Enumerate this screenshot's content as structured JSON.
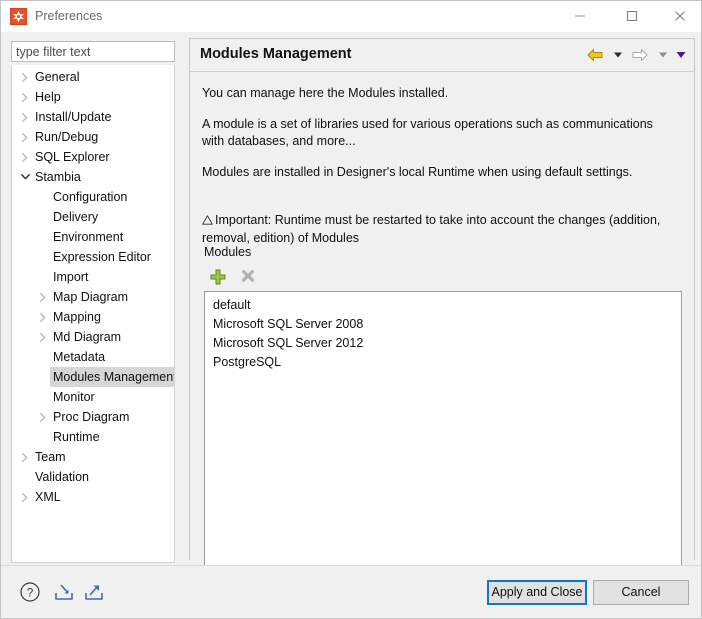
{
  "window": {
    "title": "Preferences",
    "app_icon": "stambia-logo-icon",
    "controls": {
      "minimize": "minimize-icon",
      "maximize": "maximize-icon",
      "close": "close-icon"
    }
  },
  "sidebar": {
    "filter": {
      "value": "",
      "placeholder": "type filter text"
    },
    "items": [
      {
        "label": "General",
        "indent": 0,
        "state": "collapsed"
      },
      {
        "label": "Help",
        "indent": 0,
        "state": "collapsed"
      },
      {
        "label": "Install/Update",
        "indent": 0,
        "state": "collapsed"
      },
      {
        "label": "Run/Debug",
        "indent": 0,
        "state": "collapsed"
      },
      {
        "label": "SQL Explorer",
        "indent": 0,
        "state": "collapsed"
      },
      {
        "label": "Stambia",
        "indent": 0,
        "state": "expanded"
      },
      {
        "label": "Configuration",
        "indent": 1,
        "state": "leaf"
      },
      {
        "label": "Delivery",
        "indent": 1,
        "state": "leaf"
      },
      {
        "label": "Environment",
        "indent": 1,
        "state": "leaf"
      },
      {
        "label": "Expression Editor",
        "indent": 1,
        "state": "leaf"
      },
      {
        "label": "Import",
        "indent": 1,
        "state": "leaf"
      },
      {
        "label": "Map Diagram",
        "indent": 1,
        "state": "collapsed"
      },
      {
        "label": "Mapping",
        "indent": 1,
        "state": "collapsed"
      },
      {
        "label": "Md Diagram",
        "indent": 1,
        "state": "collapsed"
      },
      {
        "label": "Metadata",
        "indent": 1,
        "state": "leaf"
      },
      {
        "label": "Modules Management",
        "indent": 1,
        "state": "leaf",
        "selected": true
      },
      {
        "label": "Monitor",
        "indent": 1,
        "state": "leaf"
      },
      {
        "label": "Proc Diagram",
        "indent": 1,
        "state": "collapsed"
      },
      {
        "label": "Runtime",
        "indent": 1,
        "state": "leaf"
      },
      {
        "label": "Team",
        "indent": 0,
        "state": "collapsed"
      },
      {
        "label": "Validation",
        "indent": 0,
        "state": "leaf"
      },
      {
        "label": "XML",
        "indent": 0,
        "state": "collapsed"
      }
    ]
  },
  "pane": {
    "title": "Modules Management",
    "nav": {
      "back": "back-arrow-icon",
      "back_menu": "chevron-down-icon",
      "forward": "forward-arrow-icon",
      "forward_menu": "chevron-down-icon",
      "view_menu": "chevron-down-icon"
    },
    "paragraphs": {
      "p1": "You can manage here the Modules installed.",
      "p2": "A module is a set of libraries used for various operations such as communications with databases, and more...",
      "p3": "Modules are installed in Designer's local Runtime when using default settings.",
      "p4_icon": "warning-triangle-icon",
      "p4": "Important: Runtime must be restarted to take into account the changes (addition, removal, edition) of Modules"
    },
    "group_label": "Modules",
    "toolbar": {
      "add": "add-plus-icon",
      "remove": "remove-cross-icon"
    },
    "modules": [
      "default",
      "Microsoft SQL Server 2008",
      "Microsoft SQL Server 2012",
      "PostgreSQL"
    ]
  },
  "footer": {
    "help_icon": "help-question-icon",
    "import_icon": "import-preferences-icon",
    "export_icon": "export-preferences-icon",
    "apply_and_close": "Apply and Close",
    "cancel": "Cancel"
  },
  "colors": {
    "accent": "#1175cf",
    "app_icon": "#e8502a",
    "add_icon": "#8cbd3f",
    "selection": "#d6d6d6",
    "back_arrow": "#f0c419"
  }
}
